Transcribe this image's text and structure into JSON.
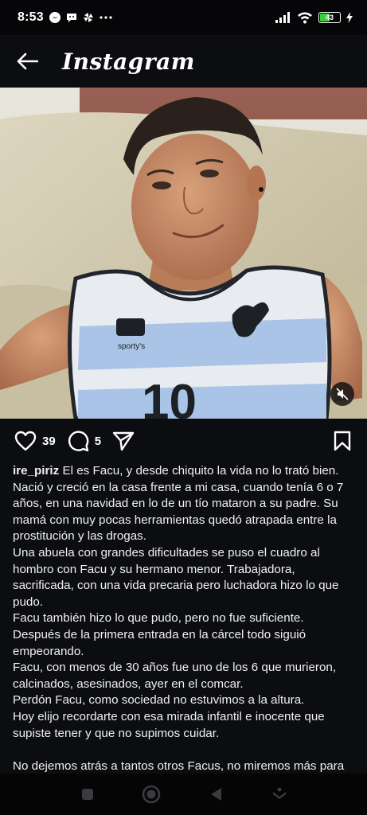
{
  "status_bar": {
    "time": "8:53",
    "left_icons": [
      "messenger-icon",
      "chat-bubble-icon",
      "pinwheel-icon",
      "more-dots-icon"
    ],
    "right_icons": [
      "signal-icon",
      "wifi-icon",
      "battery-icon",
      "charging-bolt-icon"
    ],
    "battery_level": "43",
    "battery_color": "#3ad13a"
  },
  "header": {
    "title": "Instagram",
    "back_icon": "arrow-left-icon"
  },
  "post": {
    "media_description_icon": "muted-speaker-icon",
    "likes": "39",
    "comments": "5",
    "username": "ire_piriz",
    "paragraphs": [
      "El es Facu, y desde chiquito la vida no lo trató bien. Nació y creció en la casa frente a mi casa, cuando tenía 6 o 7 años, en una navidad en lo de un tío mataron a su padre. Su mamá con muy pocas herramientas quedó atrapada entre la prostitución y las drogas.",
      "Una abuela con grandes dificultades se puso el cuadro al hombro con Facu y su hermano menor. Trabajadora, sacrificada, con una vida precaria pero luchadora hizo lo que pudo.",
      "Facu también hizo lo que pudo, pero no fue suficiente.",
      "Después de la primera entrada en la cárcel todo siguió empeorando.",
      "Facu, con menos de 30 años fue uno de los 6 que murieron, calcinados, asesinados, ayer en el comcar.",
      "Perdón Facu, como sociedad no estuvimos a la altura.",
      "Hoy elijo recordarte con esa mirada infantil e inocente que supiste tener y que no supimos cuidar.",
      "No dejemos atrás a tantos otros Facus, no miremos más para el costado…"
    ]
  },
  "nav_bar": {
    "buttons": [
      "recents-square-icon",
      "home-circle-icon",
      "back-triangle-icon",
      "assistant-icon"
    ]
  }
}
